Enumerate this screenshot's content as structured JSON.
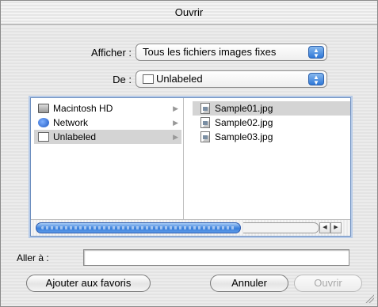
{
  "window": {
    "title": "Ouvrir"
  },
  "show": {
    "label": "Afficher :",
    "value": "Tous les fichiers images fixes"
  },
  "from": {
    "label": "De :",
    "value": "Unlabeled"
  },
  "sidebar": {
    "items": [
      {
        "label": "Macintosh HD",
        "icon": "hard-drive-icon"
      },
      {
        "label": "Network",
        "icon": "network-globe-icon"
      },
      {
        "label": "Unlabeled",
        "icon": "volume-icon"
      }
    ]
  },
  "files": {
    "items": [
      {
        "label": "Sample01.jpg"
      },
      {
        "label": "Sample02.jpg"
      },
      {
        "label": "Sample03.jpg"
      }
    ]
  },
  "goto": {
    "label": "Aller à :",
    "value": ""
  },
  "buttons": {
    "favorites": "Ajouter aux favoris",
    "cancel": "Annuler",
    "open": "Ouvrir"
  }
}
